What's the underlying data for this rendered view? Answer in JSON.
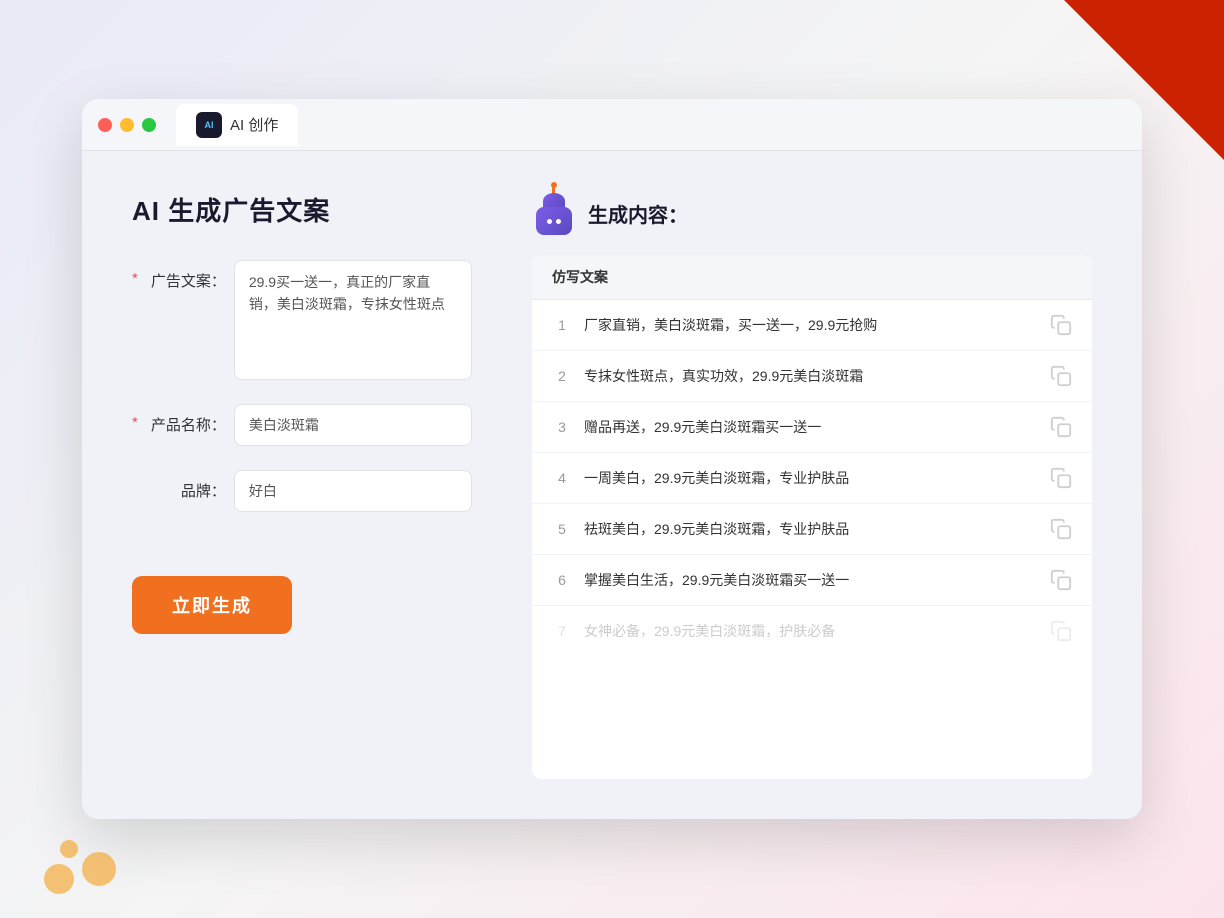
{
  "window": {
    "tab_label": "AI 创作"
  },
  "left": {
    "title": "AI 生成广告文案",
    "fields": [
      {
        "label": "广告文案：",
        "required": true,
        "type": "textarea",
        "value": "29.9买一送一，真正的厂家直销，美白淡斑霜，专抹女性斑点",
        "name": "ad-copy-input"
      },
      {
        "label": "产品名称：",
        "required": true,
        "type": "text",
        "value": "美白淡斑霜",
        "name": "product-name-input"
      },
      {
        "label": "品牌：",
        "required": false,
        "type": "text",
        "value": "好白",
        "name": "brand-input"
      }
    ],
    "button_label": "立即生成"
  },
  "right": {
    "title": "生成内容：",
    "column_header": "仿写文案",
    "results": [
      {
        "num": "1",
        "text": "厂家直销，美白淡斑霜，买一送一，29.9元抢购"
      },
      {
        "num": "2",
        "text": "专抹女性斑点，真实功效，29.9元美白淡斑霜"
      },
      {
        "num": "3",
        "text": "赠品再送，29.9元美白淡斑霜买一送一"
      },
      {
        "num": "4",
        "text": "一周美白，29.9元美白淡斑霜，专业护肤品"
      },
      {
        "num": "5",
        "text": "祛斑美白，29.9元美白淡斑霜，专业护肤品"
      },
      {
        "num": "6",
        "text": "掌握美白生活，29.9元美白淡斑霜买一送一"
      },
      {
        "num": "7",
        "text": "女神必备，29.9元美白淡斑霜，护肤必备",
        "faded": true
      }
    ]
  }
}
